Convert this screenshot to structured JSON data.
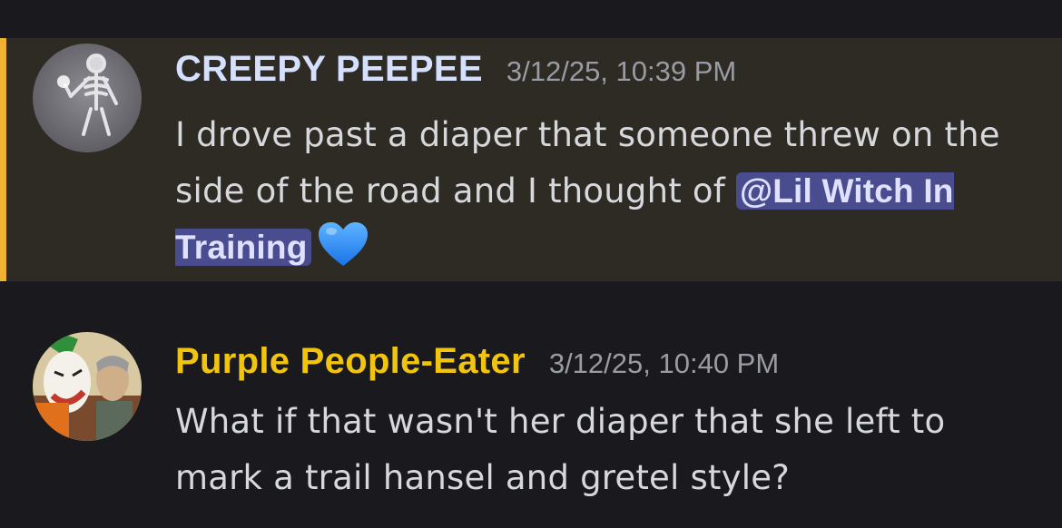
{
  "messages": [
    {
      "username": "CREEPY PEEPEE",
      "username_color": "#d5e0ff",
      "timestamp": "3/12/25, 10:39 PM",
      "highlighted": true,
      "highlight_bar_color": "#f0b232",
      "avatar_icon": "skeleton-avatar",
      "text_before": "I drove past a diaper that someone threw on the side of the road and I thought of ",
      "mention": "@Lil Witch In Training",
      "emoji": "blue-heart-icon"
    },
    {
      "username": "Purple People-Eater",
      "username_color": "#f1c40f",
      "timestamp": "3/12/25, 10:40 PM",
      "highlighted": false,
      "avatar_icon": "joker-avatar",
      "text": "What if that wasn't her diaper that she left to mark a trail hansel and gretel style?"
    }
  ]
}
